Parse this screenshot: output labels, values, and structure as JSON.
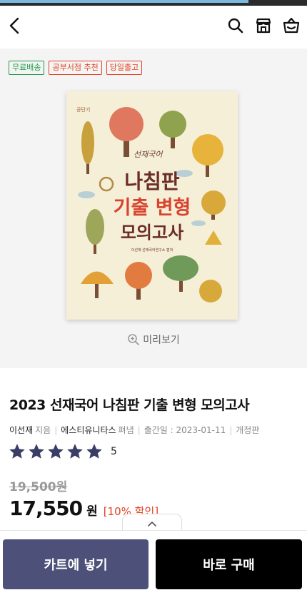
{
  "scroll_progress": 0.81,
  "header": {
    "back_icon": "chevron-left-icon",
    "icons": [
      "search-icon",
      "store-icon",
      "basket-icon"
    ]
  },
  "tags": [
    {
      "label": "무료배송",
      "color": "#1c9a48"
    },
    {
      "label": "공부서점 추천",
      "color": "#e2401f"
    },
    {
      "label": "당일출고",
      "color": "#e2401f"
    }
  ],
  "cover": {
    "publisher_mark": "공단기",
    "script_title": "선재국어",
    "line1": "나침판",
    "line2": "기출 변형",
    "line3": "모의고사",
    "author_line": "이선재 선재국어연구소 편저"
  },
  "preview_label": "미리보기",
  "product": {
    "title": "2023 선재국어 나침판 기출 변형 모의고사",
    "author": "이선재",
    "author_role": "지음",
    "publisher": "에스티유니타스",
    "publisher_role": "펴냄",
    "pubdate_label": "출간일 : 2023-01-11",
    "edition": "개정판",
    "rating_stars": 5,
    "rating_score": "5",
    "original_price": "19,500원",
    "sale_price": "17,550",
    "currency": "원",
    "discount": "[10% 할인]"
  },
  "buttons": {
    "cart": "카트에 넣기",
    "buy": "바로 구매"
  },
  "colors": {
    "cart_button": "#4d5079",
    "buy_button": "#000000",
    "discount": "#e2401f",
    "star": "#3a3d66"
  }
}
